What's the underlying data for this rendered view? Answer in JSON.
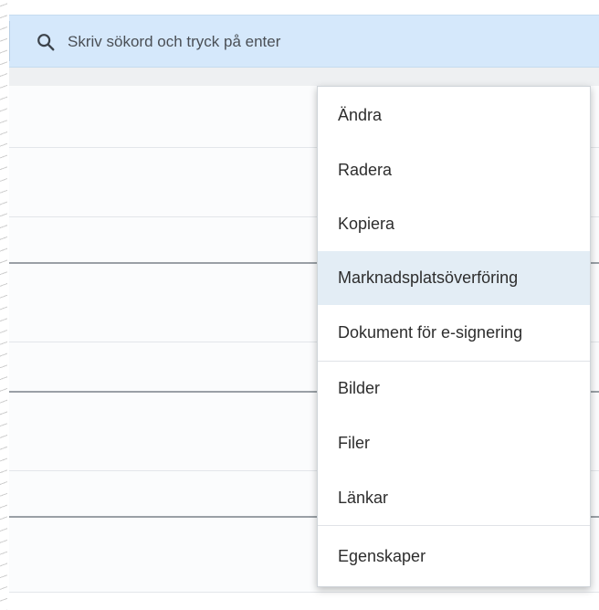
{
  "search": {
    "placeholder": "Skriv sökord och tryck på enter",
    "icon": "search-icon"
  },
  "context_menu": {
    "items": [
      {
        "label": "Ändra"
      },
      {
        "label": "Radera"
      },
      {
        "label": "Kopiera"
      },
      {
        "label": "Marknadsplatsöverföring",
        "highlighted": true
      },
      {
        "label": "Dokument för e-signering"
      },
      {
        "label": "Bilder"
      },
      {
        "label": "Filer"
      },
      {
        "label": "Länkar"
      },
      {
        "label": "Egenskaper"
      }
    ]
  },
  "colors": {
    "search_bar_bg": "#d5e8fb",
    "highlight_bg": "#e3edf5",
    "text": "#2d2d2d"
  }
}
